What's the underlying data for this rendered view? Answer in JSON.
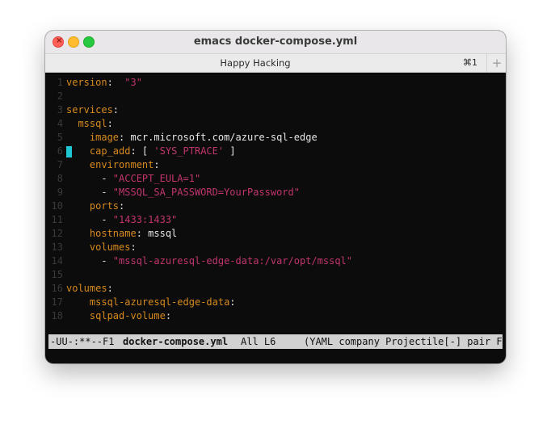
{
  "window": {
    "title": "emacs docker-compose.yml",
    "close_glyph": "×"
  },
  "tab": {
    "label": "Happy Hacking",
    "shortcut": "⌘1",
    "add_symbol": "+"
  },
  "editor": {
    "lines": [
      {
        "num": "1",
        "tokens": [
          [
            "key",
            "version"
          ],
          [
            "plain",
            ":  "
          ],
          [
            "str",
            "\"3\""
          ]
        ]
      },
      {
        "num": "2",
        "tokens": []
      },
      {
        "num": "3",
        "tokens": [
          [
            "key",
            "services"
          ],
          [
            "plain",
            ":"
          ]
        ]
      },
      {
        "num": "4",
        "tokens": [
          [
            "plain",
            "  "
          ],
          [
            "key",
            "mssql"
          ],
          [
            "plain",
            ":"
          ]
        ]
      },
      {
        "num": "5",
        "tokens": [
          [
            "plain",
            "    "
          ],
          [
            "key",
            "image"
          ],
          [
            "plain",
            ": mcr.microsoft.com/azure-sql-edge"
          ]
        ]
      },
      {
        "num": "6",
        "tokens": [
          [
            "plain",
            "    "
          ],
          [
            "key",
            "cap_add"
          ],
          [
            "plain",
            ": [ "
          ],
          [
            "str",
            "'SYS_PTRACE'"
          ],
          [
            "plain",
            " ]"
          ]
        ]
      },
      {
        "num": "7",
        "tokens": [
          [
            "plain",
            "    "
          ],
          [
            "key",
            "environment"
          ],
          [
            "plain",
            ":"
          ]
        ]
      },
      {
        "num": "8",
        "tokens": [
          [
            "plain",
            "      - "
          ],
          [
            "str",
            "\"ACCEPT_EULA=1\""
          ]
        ]
      },
      {
        "num": "9",
        "tokens": [
          [
            "plain",
            "      - "
          ],
          [
            "str",
            "\"MSSQL_SA_PASSWORD=YourPassword\""
          ]
        ]
      },
      {
        "num": "10",
        "tokens": [
          [
            "plain",
            "    "
          ],
          [
            "key",
            "ports"
          ],
          [
            "plain",
            ":"
          ]
        ]
      },
      {
        "num": "11",
        "tokens": [
          [
            "plain",
            "      - "
          ],
          [
            "str",
            "\"1433:1433\""
          ]
        ]
      },
      {
        "num": "12",
        "tokens": [
          [
            "plain",
            "    "
          ],
          [
            "key",
            "hostname"
          ],
          [
            "plain",
            ": mssql"
          ]
        ]
      },
      {
        "num": "13",
        "tokens": [
          [
            "plain",
            "    "
          ],
          [
            "key",
            "volumes"
          ],
          [
            "plain",
            ":"
          ]
        ]
      },
      {
        "num": "14",
        "tokens": [
          [
            "plain",
            "      - "
          ],
          [
            "str",
            "\"mssql-azuresql-edge-data:/var/opt/mssql\""
          ]
        ]
      },
      {
        "num": "15",
        "tokens": []
      },
      {
        "num": "16",
        "tokens": [
          [
            "key",
            "volumes"
          ],
          [
            "plain",
            ":"
          ]
        ]
      },
      {
        "num": "17",
        "tokens": [
          [
            "plain",
            "    "
          ],
          [
            "key",
            "mssql-azuresql-edge-data"
          ],
          [
            "plain",
            ":"
          ]
        ]
      },
      {
        "num": "18",
        "tokens": [
          [
            "plain",
            "    "
          ],
          [
            "key",
            "sqlpad-volume"
          ],
          [
            "plain",
            ":"
          ]
        ]
      }
    ],
    "cursor_line": "6"
  },
  "modeline": {
    "status": "-UU-:**--F1",
    "buffer": "docker-compose.yml",
    "position": "All L6",
    "modes": "(YAML company Projectile[-] pair Fl"
  },
  "colors": {
    "key": "#d78a1e",
    "string": "#c0356e",
    "cursor": "#1fc7d4"
  }
}
